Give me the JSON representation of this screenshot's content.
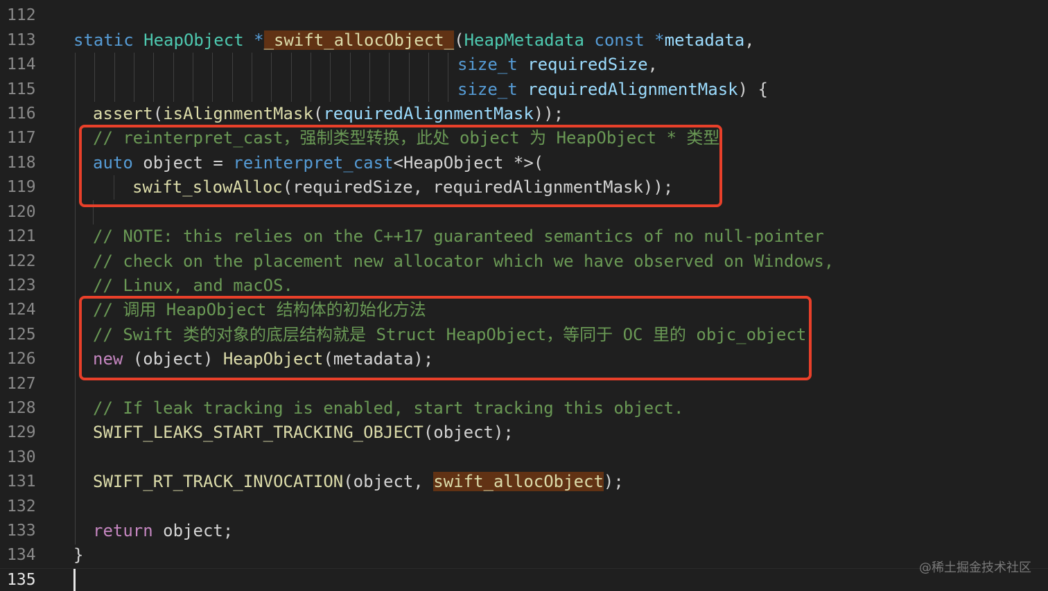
{
  "editor": {
    "line_numbers": [
      "112",
      "113",
      "114",
      "115",
      "116",
      "117",
      "118",
      "119",
      "120",
      "121",
      "122",
      "123",
      "124",
      "125",
      "126",
      "127",
      "128",
      "129",
      "130",
      "131",
      "132",
      "133",
      "134",
      "135"
    ],
    "active_line": "135",
    "colors": {
      "background": "#1f1f1f",
      "keyword": "#569cd6",
      "control_keyword": "#c586c0",
      "type": "#4ec9b0",
      "function": "#dcdcaa",
      "variable": "#9cdcfe",
      "comment": "#6a9955",
      "text": "#d4d4d4",
      "highlight": "#613214",
      "annotation_box": "#e8402a"
    },
    "tokens": {
      "l113": {
        "static": "static",
        "heapobject_type": "HeapObject",
        "star": " *",
        "func_name": "_swift_allocObject_",
        "open_paren": "(",
        "heapmetadata_type": "HeapMetadata",
        "const": "const",
        "ptr": " *",
        "metadata": "metadata",
        "comma": ","
      },
      "l114": {
        "type": "size_t",
        "param": "requiredSize",
        "comma": ","
      },
      "l115": {
        "type": "size_t",
        "param": "requiredAlignmentMask",
        "close": ") {"
      },
      "l116": {
        "assert": "assert",
        "open": "(",
        "is_mask": "isAlignmentMask",
        "open2": "(",
        "arg": "requiredAlignmentMask",
        "close": "));"
      },
      "l117": {
        "comment": "// reinterpret_cast，强制类型转换，此处 object 为 HeapObject * 类型"
      },
      "l118": {
        "auto": "auto",
        "object": " object = ",
        "cast": "reinterpret_cast",
        "lt": "<",
        "type": "HeapObject",
        "rest": " *>("
      },
      "l119": {
        "fn": "swift_slowAlloc",
        "args": "(requiredSize, requiredAlignmentMask));"
      },
      "l121": {
        "comment": "// NOTE: this relies on the C++17 guaranteed semantics of no null-pointer"
      },
      "l122": {
        "comment": "// check on the placement new allocator which we have observed on Windows,"
      },
      "l123": {
        "comment": "// Linux, and macOS."
      },
      "l124": {
        "comment": "// 调用 HeapObject 结构体的初始化方法"
      },
      "l125": {
        "comment": "// Swift 类的对象的底层结构就是 Struct HeapObject，等同于 OC 里的 objc_object"
      },
      "l126": {
        "new": "new",
        "object": " (object) ",
        "fn": "HeapObject",
        "args": "(metadata);"
      },
      "l128": {
        "comment": "// If leak tracking is enabled, start tracking this object."
      },
      "l129": {
        "fn": "SWIFT_LEAKS_START_TRACKING_OBJECT",
        "args": "(object);"
      },
      "l131": {
        "fn": "SWIFT_RT_TRACK_INVOCATION",
        "args": "(object, ",
        "highlighted": "swift_allocObject",
        "close": ");"
      },
      "l133": {
        "return": "return",
        "rest": " object;"
      },
      "l134": {
        "brace": "}"
      }
    }
  },
  "watermark": "@稀土掘金技术社区"
}
